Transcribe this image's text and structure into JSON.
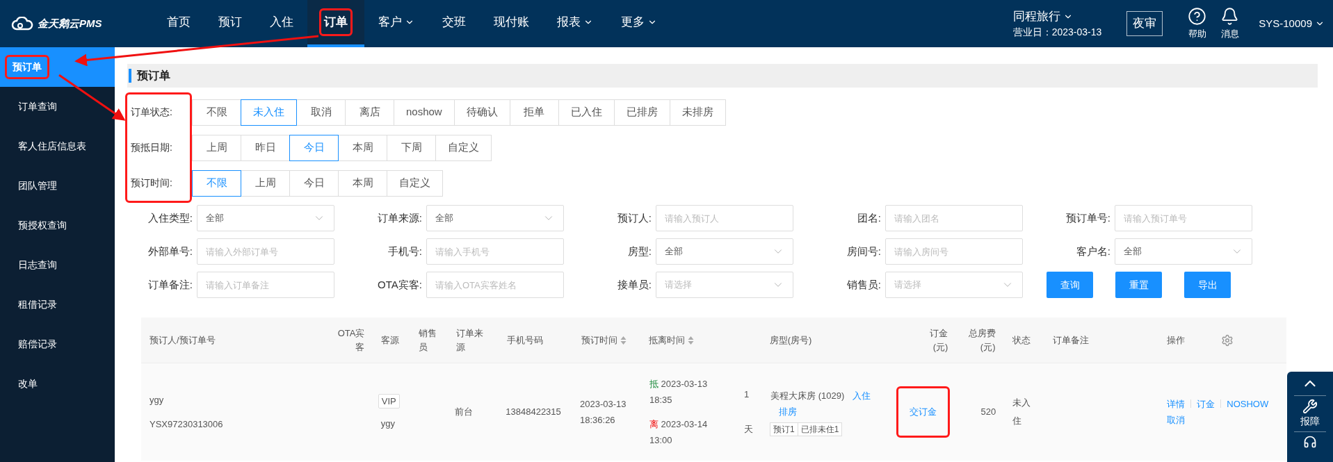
{
  "top_bar": {
    "logo_text": "金天鹅云PMS",
    "nav": [
      {
        "label": "首页",
        "dropdown": false,
        "selected": false,
        "highlighted": false
      },
      {
        "label": "预订",
        "dropdown": false,
        "selected": false,
        "highlighted": false
      },
      {
        "label": "入住",
        "dropdown": false,
        "selected": false,
        "highlighted": false
      },
      {
        "label": "订单",
        "dropdown": false,
        "selected": true,
        "highlighted": true
      },
      {
        "label": "客户",
        "dropdown": true,
        "selected": false,
        "highlighted": false
      },
      {
        "label": "交班",
        "dropdown": false,
        "selected": false,
        "highlighted": false
      },
      {
        "label": "现付账",
        "dropdown": false,
        "selected": false,
        "highlighted": false
      },
      {
        "label": "报表",
        "dropdown": true,
        "selected": false,
        "highlighted": false
      },
      {
        "label": "更多",
        "dropdown": true,
        "selected": false,
        "highlighted": false
      }
    ],
    "hotel": "同程旅行",
    "business_day": "营业日：2023-03-13",
    "night_audit": "夜审",
    "help": "帮助",
    "messages": "消息",
    "user": "SYS-10009"
  },
  "sidebar": {
    "items": [
      {
        "label": "预订单",
        "selected": true,
        "highlighted": true
      },
      {
        "label": "订单查询",
        "selected": false,
        "highlighted": false
      },
      {
        "label": "客人住店信息表",
        "selected": false,
        "highlighted": false
      },
      {
        "label": "团队管理",
        "selected": false,
        "highlighted": false
      },
      {
        "label": "预授权查询",
        "selected": false,
        "highlighted": false
      },
      {
        "label": "日志查询",
        "selected": false,
        "highlighted": false
      },
      {
        "label": "租借记录",
        "selected": false,
        "highlighted": false
      },
      {
        "label": "赔偿记录",
        "selected": false,
        "highlighted": false
      },
      {
        "label": "改单",
        "selected": false,
        "highlighted": false
      }
    ]
  },
  "page_title": "预订单",
  "filter_labels_highlighted": true,
  "filter_groups": [
    {
      "label": "订单状态:",
      "options": [
        {
          "label": "不限",
          "selected": false
        },
        {
          "label": "未入住",
          "selected": true
        },
        {
          "label": "取消",
          "selected": false
        },
        {
          "label": "离店",
          "selected": false
        },
        {
          "label": "noshow",
          "selected": false
        },
        {
          "label": "待确认",
          "selected": false
        },
        {
          "label": "拒单",
          "selected": false
        },
        {
          "label": "已入住",
          "selected": false
        },
        {
          "label": "已排房",
          "selected": false
        },
        {
          "label": "未排房",
          "selected": false
        }
      ]
    },
    {
      "label": "预抵日期:",
      "options": [
        {
          "label": "上周",
          "selected": false
        },
        {
          "label": "昨日",
          "selected": false
        },
        {
          "label": "今日",
          "selected": true
        },
        {
          "label": "本周",
          "selected": false
        },
        {
          "label": "下周",
          "selected": false
        },
        {
          "label": "自定义",
          "selected": false
        }
      ]
    },
    {
      "label": "预订时间:",
      "options": [
        {
          "label": "不限",
          "selected": true
        },
        {
          "label": "上周",
          "selected": false
        },
        {
          "label": "今日",
          "selected": false
        },
        {
          "label": "本周",
          "selected": false
        },
        {
          "label": "自定义",
          "selected": false
        }
      ]
    }
  ],
  "form_fields": [
    {
      "label": "入住类型:",
      "kind": "select",
      "value": "全部"
    },
    {
      "label": "订单来源:",
      "kind": "select",
      "value": "全部"
    },
    {
      "label": "预订人:",
      "kind": "input",
      "placeholder": "请输入预订人"
    },
    {
      "label": "团名:",
      "kind": "input",
      "placeholder": "请输入团名"
    },
    {
      "label": "预订单号:",
      "kind": "input",
      "placeholder": "请输入预订单号"
    },
    {
      "label": "外部单号:",
      "kind": "input",
      "placeholder": "请输入外部订单号"
    },
    {
      "label": "手机号:",
      "kind": "input",
      "placeholder": "请输入手机号"
    },
    {
      "label": "房型:",
      "kind": "select",
      "value": "全部"
    },
    {
      "label": "房间号:",
      "kind": "input",
      "placeholder": "请输入房间号"
    },
    {
      "label": "客户名:",
      "kind": "select",
      "value": "全部"
    },
    {
      "label": "订单备注:",
      "kind": "input",
      "placeholder": "请输入订单备注"
    },
    {
      "label": "OTA宾客:",
      "kind": "input",
      "placeholder": "请输入OTA宾客姓名"
    },
    {
      "label": "接单员:",
      "kind": "select",
      "placeholder": "请选择"
    },
    {
      "label": "销售员:",
      "kind": "select",
      "placeholder": "请选择"
    }
  ],
  "form_buttons": [
    "查询",
    "重置",
    "导出"
  ],
  "table": {
    "columns": [
      {
        "label": "预订人/预订单号",
        "sortable": false
      },
      {
        "label": "OTA宾客",
        "sortable": false
      },
      {
        "label": "客源",
        "sortable": false
      },
      {
        "label": "销售员",
        "sortable": false
      },
      {
        "label": "订单来源",
        "sortable": false
      },
      {
        "label": "手机号码",
        "sortable": false
      },
      {
        "label": "预订时间",
        "sortable": true
      },
      {
        "label": "抵离时间",
        "sortable": true
      },
      {
        "label": "房型(房号)",
        "sortable": false
      },
      {
        "label": "订金(元)",
        "sortable": false
      },
      {
        "label": "总房费(元)",
        "sortable": false
      },
      {
        "label": "状态",
        "sortable": false
      },
      {
        "label": "订单备注",
        "sortable": false
      },
      {
        "label": "操作",
        "sortable": false
      }
    ],
    "rows": [
      {
        "booker": "ygy",
        "order_no": "YSX97230313006",
        "source_badge": "VIP",
        "source": "ygy",
        "channel": "前台",
        "phone": "13848422315",
        "booked_at": "2023-03-13 18:36:26",
        "arrival_tag": "抵",
        "arrival": "2023-03-13 18:35",
        "departure_tag": "离",
        "departure": "2023-03-14 13:00",
        "nights": "1天",
        "room": "美程大床房 (1029)",
        "room_links": [
          "入住",
          "排房"
        ],
        "room_tags": [
          "预订1",
          "已排未住1"
        ],
        "deposit": "交订金",
        "deposit_highlighted": true,
        "total": "520",
        "status": "未入住",
        "actions": [
          "详情",
          "订金",
          "NOSHOW",
          "取消"
        ]
      }
    ]
  },
  "float_panel": {
    "label": "报障"
  }
}
